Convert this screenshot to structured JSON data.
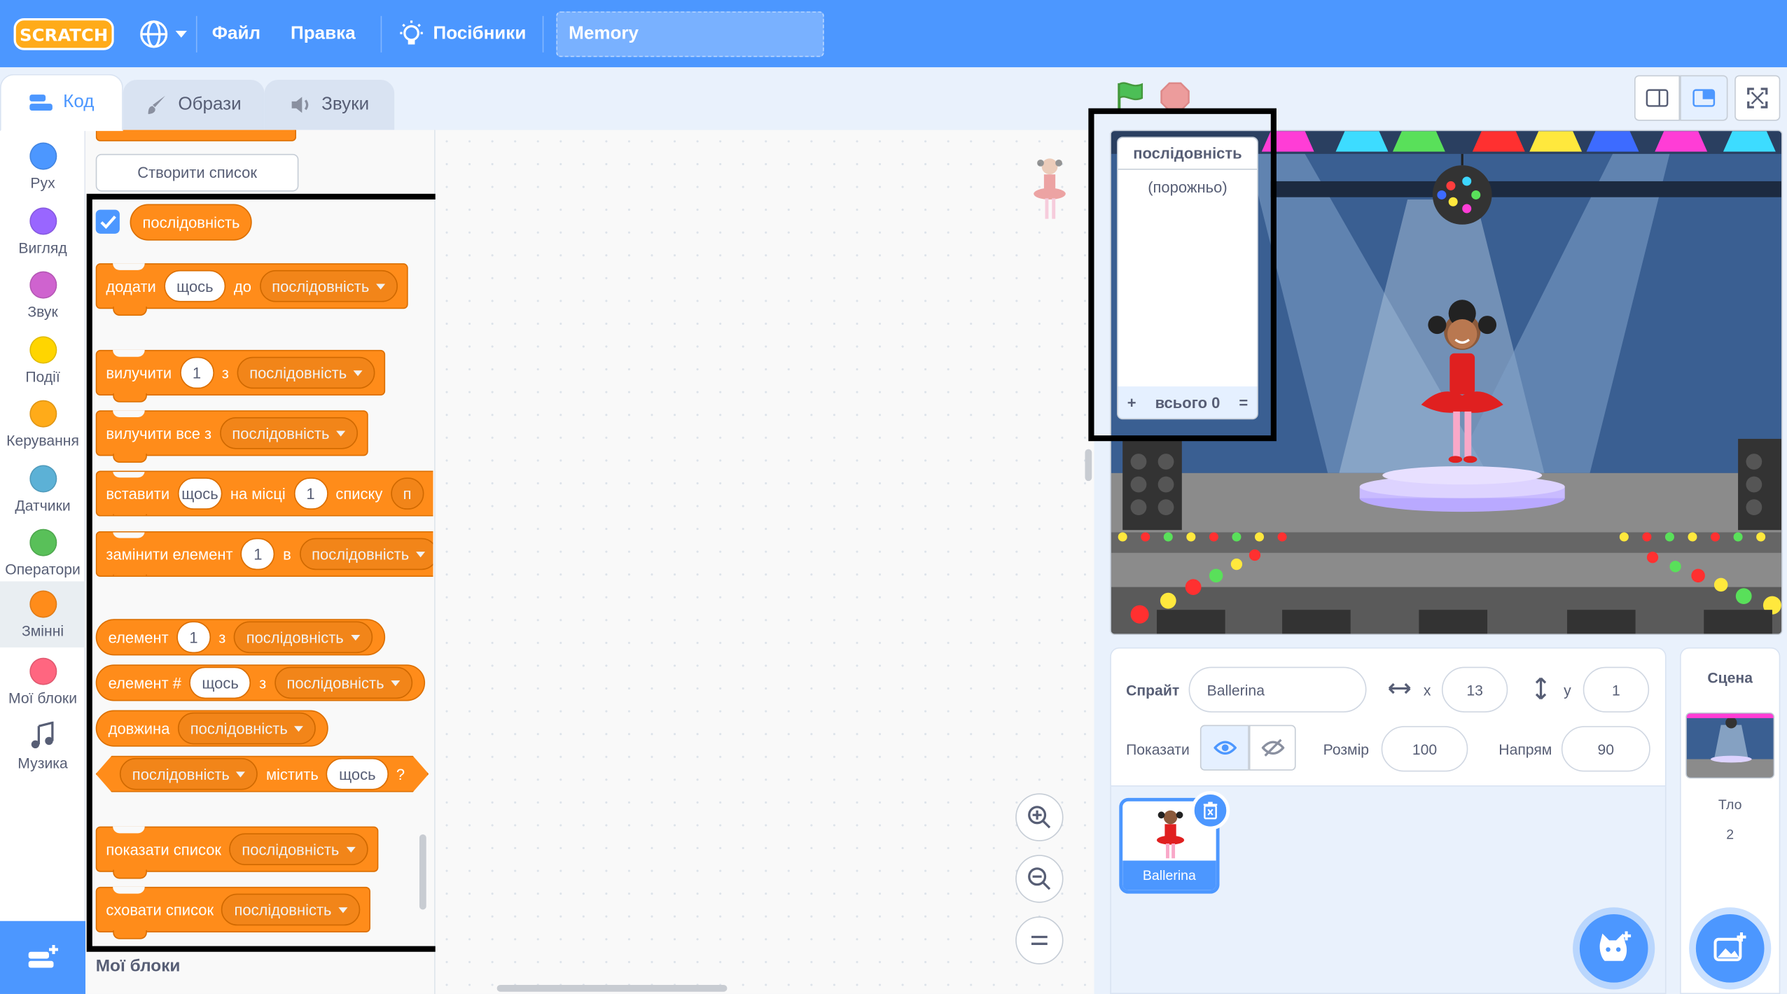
{
  "menu": {
    "file": "Файл",
    "edit": "Правка",
    "tutorials": "Посібники",
    "project_title": "Memory"
  },
  "tabs": [
    {
      "label": "Код"
    },
    {
      "label": "Образи"
    },
    {
      "label": "Звуки"
    }
  ],
  "categories": [
    {
      "label": "Рух",
      "color": "#4c97ff"
    },
    {
      "label": "Вигляд",
      "color": "#9966ff"
    },
    {
      "label": "Звук",
      "color": "#cf63cf"
    },
    {
      "label": "Події",
      "color": "#ffd500"
    },
    {
      "label": "Керування",
      "color": "#ffab19"
    },
    {
      "label": "Датчики",
      "color": "#5cb1d6"
    },
    {
      "label": "Оператори",
      "color": "#59c059"
    },
    {
      "label": "Змінні",
      "color": "#ff8c1a"
    },
    {
      "label": "Мої блоки",
      "color": "#ff6680"
    },
    {
      "label": "Музика",
      "icon": "music-note-icon"
    }
  ],
  "palette": {
    "create_list": "Створити список",
    "list_name": "послідовність",
    "something": "щось",
    "one": "1",
    "add": "додати",
    "to": "до",
    "delete": "вилучити",
    "from": "з",
    "delete_all": "вилучити все з",
    "insert": "вставити",
    "at": "на місці",
    "of_list": "списку",
    "insert_trail": "п",
    "replace": "замінити елемент",
    "in": "в",
    "item": "елемент",
    "item_num": "елемент #",
    "length": "довжина",
    "contains": "містить",
    "q": "?",
    "show_list": "показати список",
    "hide_list": "сховати список",
    "my_blocks_heading": "Мої блоки"
  },
  "stage": {
    "list_monitor": {
      "title": "послідовність",
      "empty": "(порожньо)",
      "plus": "+",
      "total": "всього 0",
      "eq": "="
    }
  },
  "sprite_info": {
    "sprite_label": "Спрайт",
    "sprite_name": "Ballerina",
    "x_label": "x",
    "x": "13",
    "y_label": "y",
    "y": "1",
    "show_label": "Показати",
    "size_label": "Розмір",
    "size": "100",
    "direction_label": "Напрям",
    "direction": "90"
  },
  "sprites": [
    {
      "name": "Ballerina"
    }
  ],
  "stage_pane": {
    "title": "Сцена",
    "backdrops_label": "Тло",
    "backdrops_count": "2"
  }
}
